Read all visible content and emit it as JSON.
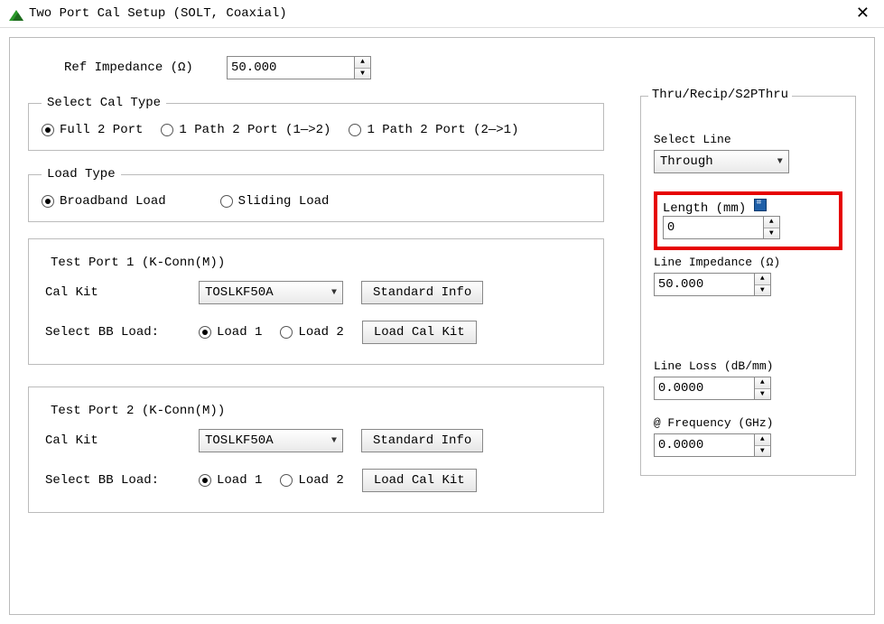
{
  "window": {
    "title": "Two Port Cal Setup (SOLT, Coaxial)"
  },
  "ref_impedance": {
    "label": "Ref Impedance (Ω)",
    "value": "50.000"
  },
  "cal_type": {
    "legend": "Select Cal Type",
    "options": {
      "full2port": "Full 2 Port",
      "path12": "1 Path 2 Port (1—>2)",
      "path21": "1 Path 2 Port (2—>1)"
    },
    "selected": "full2port"
  },
  "load_type": {
    "legend": "Load Type",
    "options": {
      "broadband": "Broadband Load",
      "sliding": "Sliding Load"
    },
    "selected": "broadband"
  },
  "port1": {
    "legend": "Test Port 1 (K-Conn(M))",
    "cal_kit_label": "Cal Kit",
    "cal_kit_value": "TOSLKF50A",
    "std_info": "Standard Info",
    "bb_label": "Select BB Load:",
    "bb_options": {
      "load1": "Load 1",
      "load2": "Load 2"
    },
    "bb_selected": "load1",
    "load_kit": "Load Cal Kit"
  },
  "port2": {
    "legend": "Test Port 2 (K-Conn(M))",
    "cal_kit_label": "Cal Kit",
    "cal_kit_value": "TOSLKF50A",
    "std_info": "Standard Info",
    "bb_label": "Select BB Load:",
    "bb_options": {
      "load1": "Load 1",
      "load2": "Load 2"
    },
    "bb_selected": "load1",
    "load_kit": "Load Cal Kit"
  },
  "right": {
    "legend": "Thru/Recip/S2PThru",
    "select_line_label": "Select Line",
    "select_line_value": "Through",
    "length_label": "Length (mm)",
    "length_value": "0",
    "line_imp_label": "Line Impedance (Ω)",
    "line_imp_value": "50.000",
    "line_loss_label": "Line Loss (dB/mm)",
    "line_loss_value": "0.0000",
    "freq_label": "@ Frequency (GHz)",
    "freq_value": "0.0000"
  }
}
